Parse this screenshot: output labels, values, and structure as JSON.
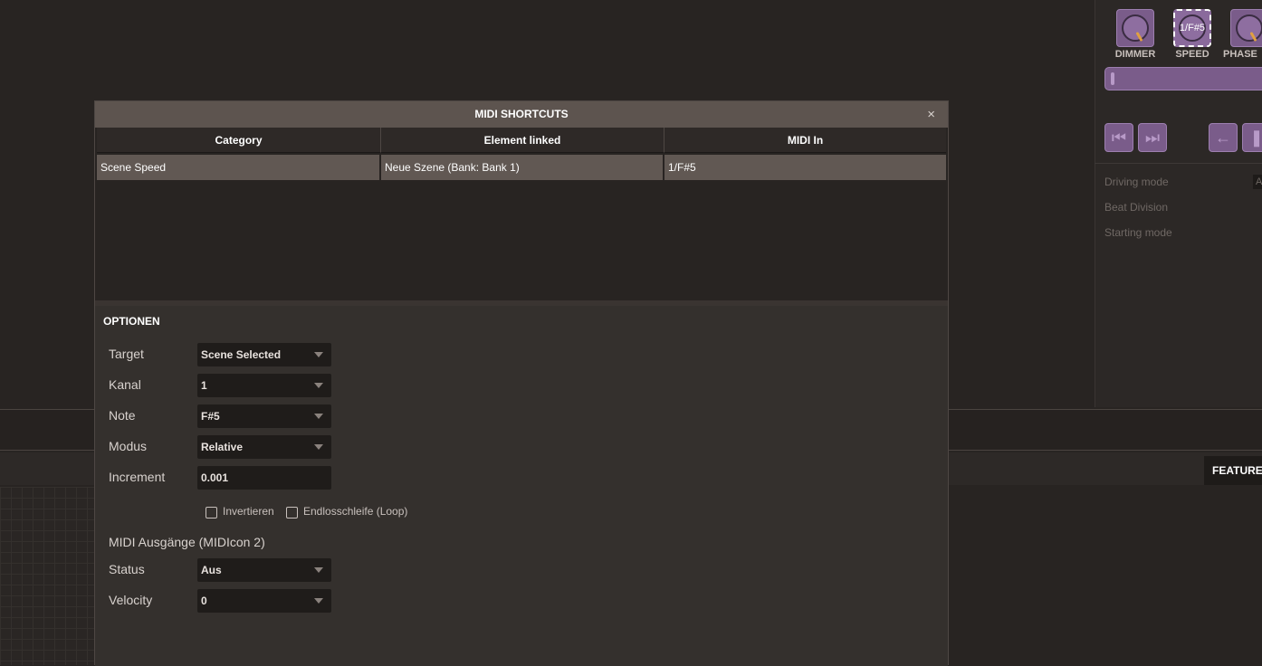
{
  "background": {
    "features_tab": "FEATURES",
    "knobs": [
      {
        "label": "DIMMER",
        "value": ""
      },
      {
        "label": "SPEED",
        "value": "1/F#5"
      },
      {
        "label": "PHASE",
        "value": ""
      }
    ],
    "transport_icons": [
      "skip-back-icon",
      "skip-forward-icon",
      "arrow-left-icon",
      "pause-icon"
    ],
    "properties": [
      {
        "label": "Driving mode",
        "value": "A"
      },
      {
        "label": "Beat Division",
        "value": ""
      },
      {
        "label": "Starting mode",
        "value": ""
      }
    ]
  },
  "dialog": {
    "title": "MIDI SHORTCUTS",
    "close": "×",
    "columns": [
      "Category",
      "Element linked",
      "MIDI In"
    ],
    "rows": [
      {
        "category": "Scene Speed",
        "element": "Neue Szene (Bank: Bank 1)",
        "midi_in": "1/F#5"
      }
    ],
    "options": {
      "title": "OPTIONEN",
      "target_label": "Target",
      "target_value": "Scene Selected",
      "kanal_label": "Kanal",
      "kanal_value": "1",
      "note_label": "Note",
      "note_value": "F#5",
      "modus_label": "Modus",
      "modus_value": "Relative",
      "increment_label": "Increment",
      "increment_value": "0.001",
      "invert_label": "Invertieren",
      "invert_checked": false,
      "loop_label": "Endlosschleife (Loop)",
      "loop_checked": false,
      "outputs_title": "MIDI Ausgänge (MIDIcon 2)",
      "status_label": "Status",
      "status_value": "Aus",
      "velocity_label": "Velocity",
      "velocity_value": "0"
    }
  },
  "colors": {
    "accent": "#7a5c8a",
    "knob_needle": "#e0a040"
  }
}
